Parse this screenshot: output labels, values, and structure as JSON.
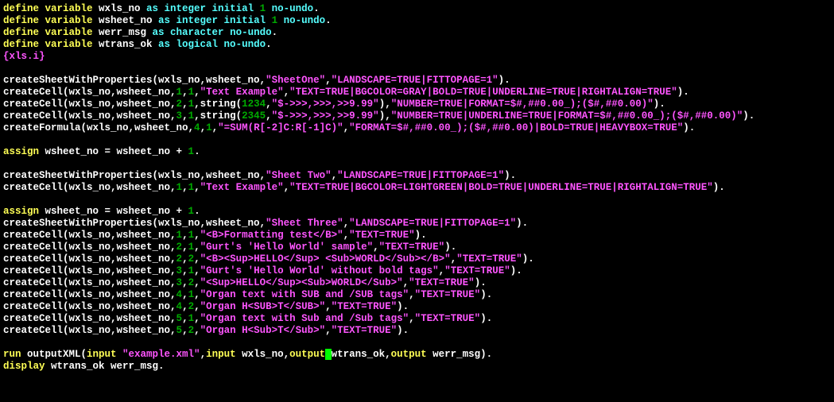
{
  "code": {
    "l1": {
      "a": "define variable",
      "b": " wxls_no ",
      "c": "as integer initial",
      "d": " 1 ",
      "e": "no-undo",
      "f": "."
    },
    "l2": {
      "a": "define variable",
      "b": " wsheet_no ",
      "c": "as integer initial",
      "d": " 1 ",
      "e": "no-undo",
      "f": "."
    },
    "l3": {
      "a": "define variable",
      "b": " werr_msg ",
      "c": "as character no-undo",
      "f": "."
    },
    "l4": {
      "a": "define variable",
      "b": " wtrans_ok ",
      "c": "as logical no-undo",
      "f": "."
    },
    "l5": "{xls.i}",
    "l6": {
      "fn": "createSheetWithProperties(wxls_no,wsheet_no,",
      "s1": "\"SheetOne\"",
      "c1": ",",
      "s2": "\"LANDSCAPE=TRUE|FITTOPAGE=1\"",
      "t": ")."
    },
    "l7": {
      "fn": "createCell(wxls_no,wsheet_no,",
      "n1": "1",
      "c1": ",",
      "n2": "1",
      "c2": ",",
      "s1": "\"Text Example\"",
      "c3": ",",
      "s2": "\"TEXT=TRUE|BGCOLOR=GRAY|BOLD=TRUE|UNDERLINE=TRUE|RIGHTALIGN=TRUE\"",
      "t": ")."
    },
    "l8": {
      "fn": "createCell(wxls_no,wsheet_no,",
      "n1": "2",
      "c1": ",",
      "n2": "1",
      "c2": ",",
      "id": "string(",
      "n3": "1234",
      "c3": ",",
      "s1": "\"$->>>,>>>,>>9.99\"",
      "id2": "),",
      "s2": "\"NUMBER=TRUE|FORMAT=$#,##0.00_);($#,##0.00)\"",
      "t": ")."
    },
    "l9": {
      "fn": "createCell(wxls_no,wsheet_no,",
      "n1": "3",
      "c1": ",",
      "n2": "1",
      "c2": ",",
      "id": "string(",
      "n3": "2345",
      "c3": ",",
      "s1": "\"$->>>,>>>,>>9.99\"",
      "id2": "),",
      "s2": "\"NUMBER=TRUE|UNDERLINE=TRUE|FORMAT=$#,##0.00_);($#,##0.00)\"",
      "t": ")."
    },
    "l10": {
      "fn": "createFormula(wxls_no,wsheet_no,",
      "n1": "4",
      "c1": ",",
      "n2": "1",
      "c2": ",",
      "s1": "\"=SUM(R[-2]C:R[-1]C)\"",
      "c3": ",",
      "s2": "\"FORMAT=$#,##0.00_);($#,##0.00)|BOLD=TRUE|HEAVYBOX=TRUE\"",
      "t": ")."
    },
    "l11": {
      "a": "assign",
      "b": " wsheet_no = wsheet_no + ",
      "n": "1",
      "t": "."
    },
    "l12": {
      "fn": "createSheetWithProperties(wxls_no,wsheet_no,",
      "s1": "\"Sheet Two\"",
      "c1": ",",
      "s2": "\"LANDSCAPE=TRUE|FITTOPAGE=1\"",
      "t": ")."
    },
    "l13": {
      "fn": "createCell(wxls_no,wsheet_no,",
      "n1": "1",
      "c1": ",",
      "n2": "1",
      "c2": ",",
      "s1": "\"Text Example\"",
      "c3": ",",
      "s2": "\"TEXT=TRUE|BGCOLOR=LIGHTGREEN|BOLD=TRUE|UNDERLINE=TRUE|RIGHTALIGN=TRUE\"",
      "t": ")."
    },
    "l14": {
      "a": "assign",
      "b": " wsheet_no = wsheet_no + ",
      "n": "1",
      "t": "."
    },
    "l15": {
      "fn": "createSheetWithProperties(wxls_no,wsheet_no,",
      "s1": "\"Sheet Three\"",
      "c1": ",",
      "s2": "\"LANDSCAPE=TRUE|FITTOPAGE=1\"",
      "t": ")."
    },
    "l16": {
      "fn": "createCell(wxls_no,wsheet_no,",
      "n1": "1",
      "c1": ",",
      "n2": "1",
      "c2": ",",
      "s1": "\"<B>Formatting test</B>\"",
      "c3": ",",
      "s2": "\"TEXT=TRUE\"",
      "t": ")."
    },
    "l17": {
      "fn": "createCell(wxls_no,wsheet_no,",
      "n1": "2",
      "c1": ",",
      "n2": "1",
      "c2": ",",
      "s1": "\"Gurt's 'Hello World' sample\"",
      "c3": ",",
      "s2": "\"TEXT=TRUE\"",
      "t": ")."
    },
    "l18": {
      "fn": "createCell(wxls_no,wsheet_no,",
      "n1": "2",
      "c1": ",",
      "n2": "2",
      "c2": ",",
      "s1": "\"<B><Sup>HELLO</Sup> <Sub>WORLD</Sub></B>\"",
      "c3": ",",
      "s2": "\"TEXT=TRUE\"",
      "t": ")."
    },
    "l19": {
      "fn": "createCell(wxls_no,wsheet_no,",
      "n1": "3",
      "c1": ",",
      "n2": "1",
      "c2": ",",
      "s1": "\"Gurt's 'Hello World' without bold tags\"",
      "c3": ",",
      "s2": "\"TEXT=TRUE\"",
      "t": ")."
    },
    "l20": {
      "fn": "createCell(wxls_no,wsheet_no,",
      "n1": "3",
      "c1": ",",
      "n2": "2",
      "c2": ",",
      "s1": "\"<Sup>HELLO</Sup><Sub>WORLD</Sub>\"",
      "c3": ",",
      "s2": "\"TEXT=TRUE\"",
      "t": ")."
    },
    "l21": {
      "fn": "createCell(wxls_no,wsheet_no,",
      "n1": "4",
      "c1": ",",
      "n2": "1",
      "c2": ",",
      "s1": "\"Organ text with SUB and /SUB tags\"",
      "c3": ",",
      "s2": "\"TEXT=TRUE\"",
      "t": ")."
    },
    "l22": {
      "fn": "createCell(wxls_no,wsheet_no,",
      "n1": "4",
      "c1": ",",
      "n2": "2",
      "c2": ",",
      "s1": "\"Organ H<SUB>T</SUB>\"",
      "c3": ",",
      "s2": "\"TEXT=TRUE\"",
      "t": ")."
    },
    "l23": {
      "fn": "createCell(wxls_no,wsheet_no,",
      "n1": "5",
      "c1": ",",
      "n2": "1",
      "c2": ",",
      "s1": "\"Organ text with Sub and /Sub tags\"",
      "c3": ",",
      "s2": "\"TEXT=TRUE\"",
      "t": ")."
    },
    "l24": {
      "fn": "createCell(wxls_no,wsheet_no,",
      "n1": "5",
      "c1": ",",
      "n2": "2",
      "c2": ",",
      "s1": "\"Organ H<Sub>T</Sub>\"",
      "c3": ",",
      "s2": "\"TEXT=TRUE\"",
      "t": ")."
    },
    "l25": {
      "a": "run",
      "b": " outputXML(",
      "c": "input ",
      "s1": "\"example.xml\"",
      "d": ",",
      "e": "input",
      "f": " wxls_no,",
      "g": "output",
      "h": " wtrans_ok,",
      "i": "output",
      "j": " werr_msg)."
    },
    "l26": {
      "a": "display",
      "b": " wtrans_ok werr_msg."
    }
  }
}
